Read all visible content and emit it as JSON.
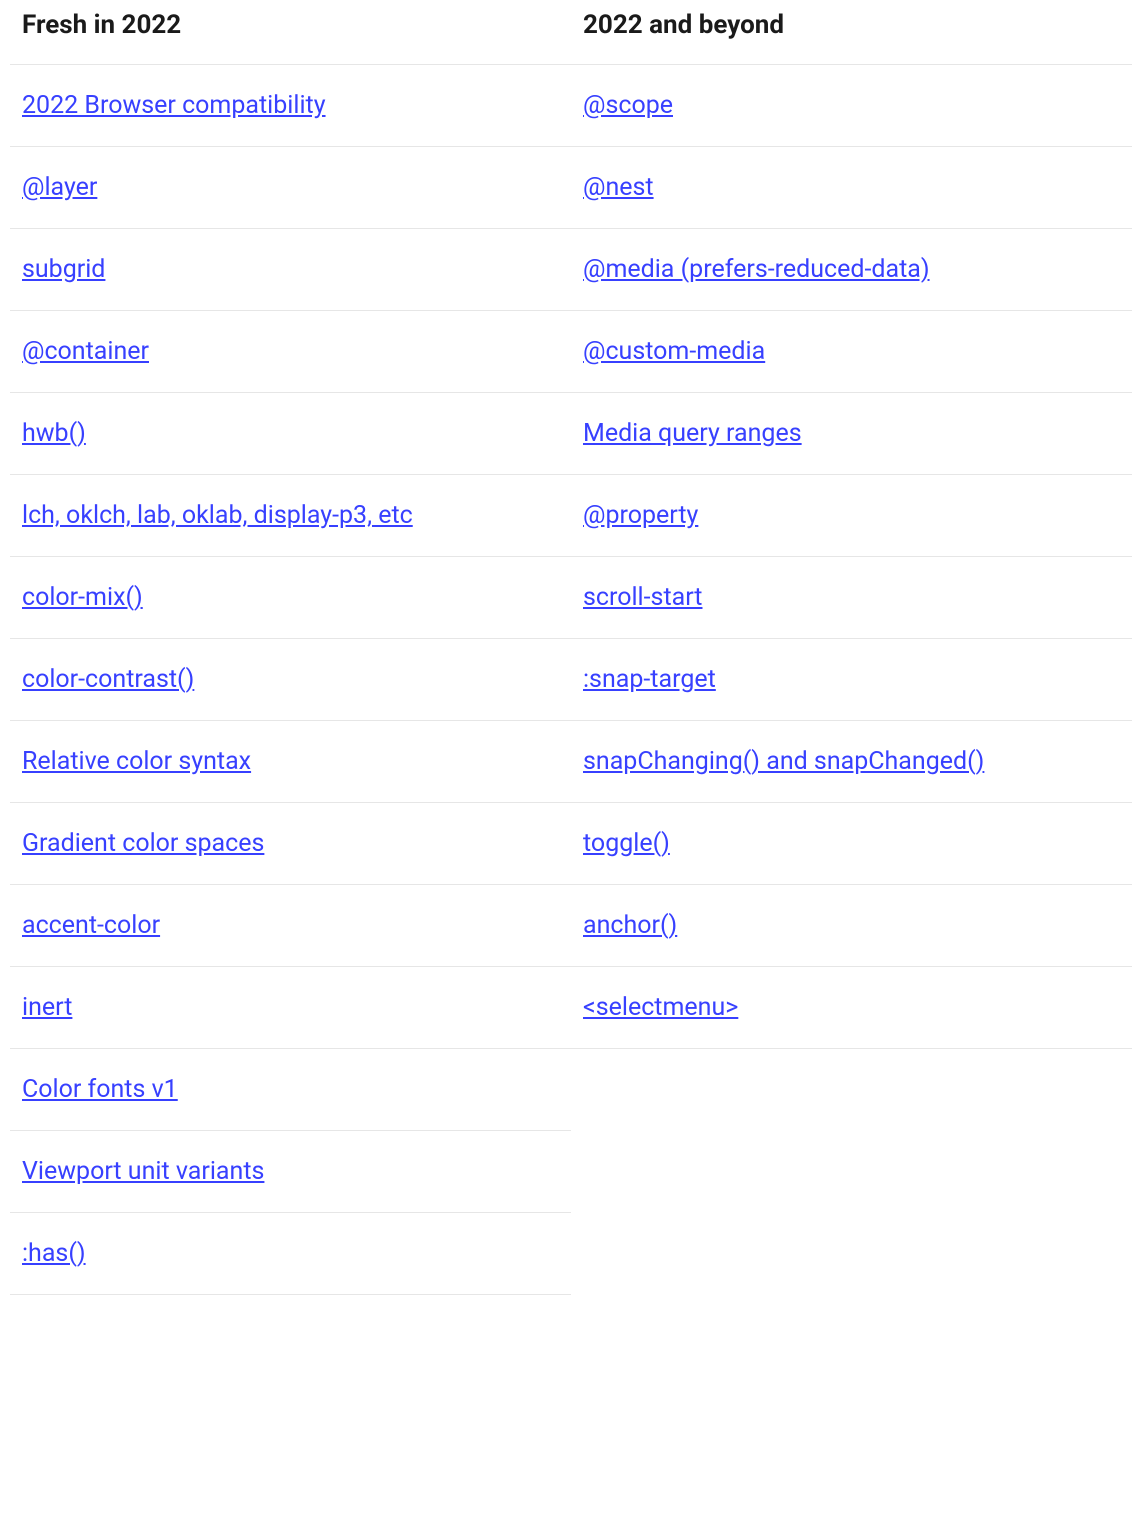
{
  "columns": [
    {
      "header": "Fresh in 2022",
      "items": [
        "2022 Browser compatibility",
        "@layer",
        "subgrid",
        "@container",
        "hwb()",
        "lch, oklch, lab, oklab, display-p3, etc",
        "color-mix()",
        "color-contrast()",
        "Relative color syntax",
        "Gradient color spaces",
        "accent-color",
        "inert",
        "Color fonts v1",
        "Viewport unit variants",
        ":has()"
      ]
    },
    {
      "header": "2022 and beyond",
      "items": [
        "@scope",
        "@nest",
        "@media (prefers-reduced-data)",
        "@custom-media",
        "Media query ranges",
        "@property",
        "scroll-start",
        ":snap-target",
        "snapChanging() and snapChanged()",
        "toggle()",
        "anchor()",
        "<selectmenu>"
      ]
    }
  ]
}
